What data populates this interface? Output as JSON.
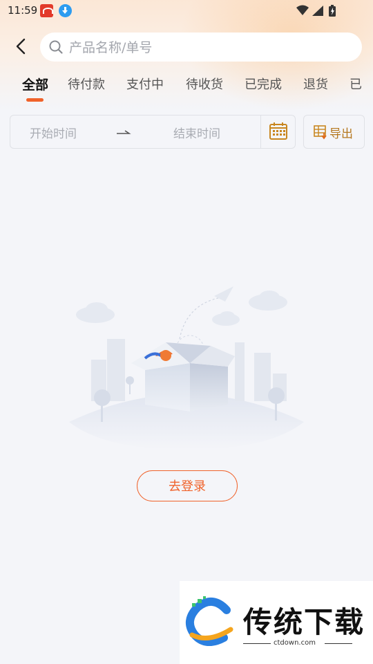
{
  "status_bar": {
    "time": "11:59",
    "icons": [
      "app-notification-icon",
      "download-icon",
      "wifi-icon",
      "signal-icon",
      "battery-icon"
    ]
  },
  "search": {
    "placeholder": "产品名称/单号",
    "value": ""
  },
  "tabs": [
    {
      "label": "全部",
      "active": true
    },
    {
      "label": "待付款",
      "active": false
    },
    {
      "label": "支付中",
      "active": false
    },
    {
      "label": "待收货",
      "active": false
    },
    {
      "label": "已完成",
      "active": false
    },
    {
      "label": "退货",
      "active": false
    },
    {
      "label": "已",
      "active": false
    }
  ],
  "date_filter": {
    "start_placeholder": "开始时间",
    "arrow": "⇀",
    "end_placeholder": "结束时间"
  },
  "export": {
    "label": "导出"
  },
  "empty_state": {
    "login_button": "去登录"
  },
  "watermark": {
    "title": "传统下载",
    "url": "ctdown.com"
  },
  "colors": {
    "accent": "#f0622a",
    "export_text": "#b5781e",
    "background": "#f4f5f9"
  }
}
